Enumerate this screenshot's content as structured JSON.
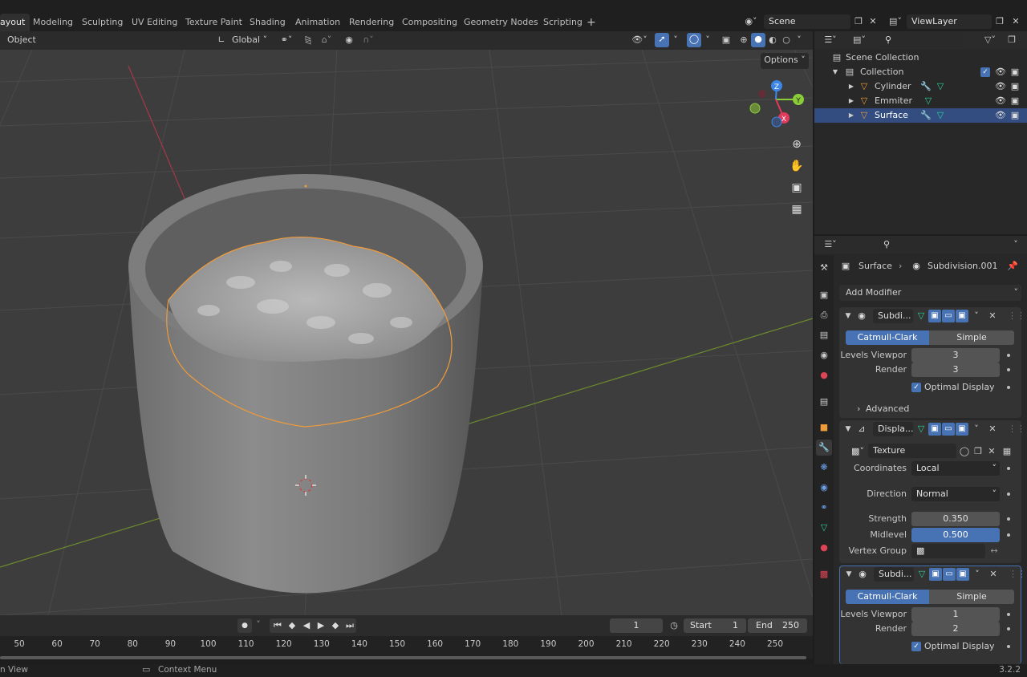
{
  "workspaces": [
    "ayout",
    "Modeling",
    "Sculpting",
    "UV Editing",
    "Texture Paint",
    "Shading",
    "Animation",
    "Rendering",
    "Compositing",
    "Geometry Nodes",
    "Scripting"
  ],
  "add_tab": "+",
  "scene_name": "Scene",
  "view_layer_name": "ViewLayer",
  "viewport_header": {
    "mode": "Object",
    "orientation": "Global"
  },
  "options_label": "Options",
  "outliner": {
    "scene_collection": "Scene Collection",
    "collection": "Collection",
    "objects": [
      {
        "name": "Cylinder",
        "selected": false
      },
      {
        "name": "Emmiter",
        "selected": false
      },
      {
        "name": "Surface",
        "selected": true
      }
    ]
  },
  "properties": {
    "breadcrumb_object": "Surface",
    "breadcrumb_modifier": "Subdivision.001",
    "add_modifier": "Add Modifier",
    "subdiv1": {
      "name": "Subdi...",
      "mode_a": "Catmull-Clark",
      "mode_b": "Simple",
      "levels_label": "Levels Viewpor",
      "levels_value": "3",
      "render_label": "Render",
      "render_value": "3",
      "optimal_label": "Optimal Display",
      "advanced_label": "Advanced"
    },
    "displace": {
      "name": "Displa...",
      "texture_label": "Texture",
      "coordinates_label": "Coordinates",
      "coordinates_value": "Local",
      "direction_label": "Direction",
      "direction_value": "Normal",
      "strength_label": "Strength",
      "strength_value": "0.350",
      "midlevel_label": "Midlevel",
      "midlevel_value": "0.500",
      "vertex_group_label": "Vertex Group"
    },
    "subdiv2": {
      "name": "Subdi...",
      "mode_a": "Catmull-Clark",
      "mode_b": "Simple",
      "levels_label": "Levels Viewpor",
      "levels_value": "1",
      "render_label": "Render",
      "render_value": "2",
      "optimal_label": "Optimal Display"
    }
  },
  "timeline": {
    "current_frame": "1",
    "start_label": "Start",
    "start_value": "1",
    "end_label": "End",
    "end_value": "250",
    "ticks": [
      "50",
      "60",
      "70",
      "80",
      "90",
      "100",
      "110",
      "120",
      "130",
      "140",
      "150",
      "160",
      "170",
      "180",
      "190",
      "200",
      "210",
      "220",
      "230",
      "240",
      "250"
    ]
  },
  "status_bar": {
    "left": "n View",
    "context": "Context Menu",
    "version": "3.2.2"
  },
  "gizmo_labels": {
    "z": "Z",
    "y": "Y",
    "x": "X"
  },
  "colors": {
    "accent": "#4772b3",
    "selected_row": "#334d80",
    "x_axis": "#e0395a",
    "y_axis": "#8acd38",
    "z_axis": "#3e86e5",
    "outline": "#f09b3a"
  }
}
